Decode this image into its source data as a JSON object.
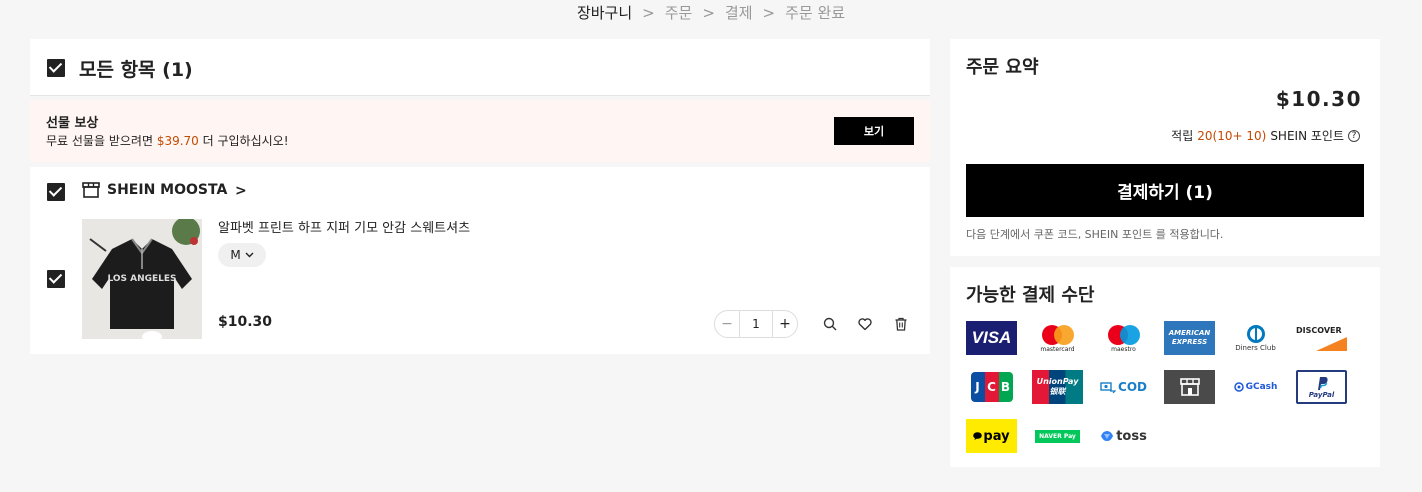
{
  "breadcrumb": {
    "step1": "장바구니",
    "step2": "주문",
    "step3": "결제",
    "step4": "주문 완료",
    "separator": ">"
  },
  "cart": {
    "select_all_label": "모든 항목 (1)",
    "gift": {
      "title": "선물 보상",
      "desc_prefix": "무료 선물을 받으려면 ",
      "amount": "$39.70",
      "desc_suffix": " 더 구입하십시오!",
      "button": "보기"
    },
    "store": {
      "name": "SHEIN MOOSTA",
      "arrow": ">"
    },
    "item": {
      "name": "알파벳 프린트 하프 지퍼 기모 안감 스웨트셔츠",
      "size": "M",
      "price": "$10.30",
      "quantity": "1",
      "minus": "−",
      "plus": "+"
    }
  },
  "summary": {
    "title": "주문 요약",
    "total": "$10.30",
    "points_prefix": "적립 ",
    "points_value": "20(10+ 10)",
    "points_suffix": " SHEIN 포인트",
    "help": "?",
    "checkout_label": "결제하기 (1)",
    "note": "다음 단계에서 쿠폰 코드, SHEIN 포인트 를 적용합니다."
  },
  "payments": {
    "title": "가능한 결제 수단",
    "methods": {
      "visa": "VISA",
      "mastercard": "mastercard",
      "maestro": "maestro",
      "amex": "AMERICAN EXPRESS",
      "diners": "Diners Club",
      "discover": "DISCOVER",
      "jcb": "JCB",
      "unionpay": "UnionPay 银联",
      "cod": "COD",
      "gcash": "GCash",
      "paypal": "PayPal",
      "kakaopay": "pay",
      "naverpay": "NAVER Pay",
      "toss": "toss"
    }
  },
  "colors": {
    "accent": "#c44a01",
    "primary_button": "#000000",
    "gift_bg": "#fff6f3"
  }
}
